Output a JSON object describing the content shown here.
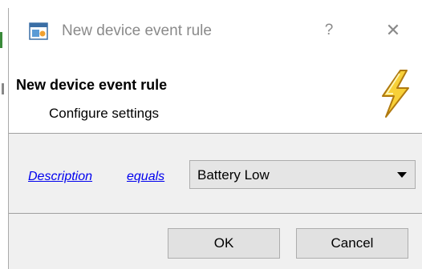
{
  "window": {
    "title": "New device event rule",
    "help_label": "?",
    "close_label": "✕"
  },
  "header": {
    "title": "New device event rule",
    "subtitle": "Configure settings"
  },
  "rule": {
    "field_link": "Description",
    "operator_link": "equals",
    "value_select": {
      "selected": "Battery Low"
    }
  },
  "footer": {
    "ok_label": "OK",
    "cancel_label": "Cancel"
  },
  "icons": {
    "app": "app-window-icon",
    "header": "lightning-bolt-icon",
    "dropdown": "chevron-down-icon"
  },
  "colors": {
    "link": "#0000ee",
    "title_text": "#8a8a8a",
    "panel_bg": "#f0f0f0",
    "bolt_fill": "#f7d038",
    "bolt_stroke": "#b07a10"
  }
}
